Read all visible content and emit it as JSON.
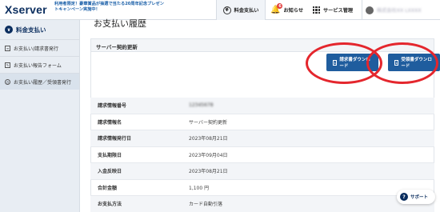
{
  "header": {
    "logo": "Xserver",
    "promo": "利用者限定！豪華賞品が抽選で当たる20周年記念プレゼントキャンペーン実施中！",
    "nav": [
      {
        "label": "料金支払い",
        "icon": "yen-icon"
      },
      {
        "label": "お知らせ",
        "icon": "bell-icon",
        "badge": "6"
      },
      {
        "label": "サービス管理",
        "icon": "grid-icon"
      },
      {
        "label": "株式会社XX LXXXX",
        "icon": "avatar"
      }
    ]
  },
  "sidebar": {
    "title": "料金支払い",
    "items": [
      {
        "label": "お支払い/請求書発行"
      },
      {
        "label": "お支払い報告フォーム"
      },
      {
        "label": "お支払い履歴／受領書発行"
      }
    ]
  },
  "main": {
    "page_title": "お支払い履歴",
    "panel_title": "サーバー契約更新",
    "buttons": {
      "invoice": "請求書ダウンロード",
      "receipt": "受領書ダウンロード"
    },
    "rows": [
      {
        "label": "請求情報番号",
        "value": "12345678"
      },
      {
        "label": "請求情報名",
        "value": "サーバー契約更新"
      },
      {
        "label": "請求情報発行日",
        "value": "2023年08月21日"
      },
      {
        "label": "支払期限日",
        "value": "2023年09月04日"
      },
      {
        "label": "入金反映日",
        "value": "2023年08月21日"
      },
      {
        "label": "合計金額",
        "value": "1,100 円"
      },
      {
        "label": "お支払方法",
        "value": "カード自動引落"
      }
    ],
    "support": "サポート"
  },
  "colors": {
    "accent": "#1f5d9e",
    "brand": "#0a2d5e",
    "highlight_ring": "#e4262d"
  }
}
